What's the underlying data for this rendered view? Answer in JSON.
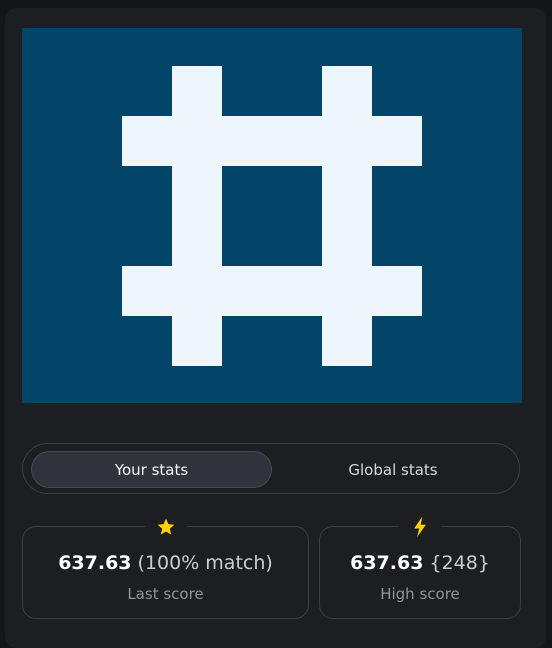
{
  "preview": {
    "background_color": "#034569",
    "glyph_color": "#eef6fc",
    "glyph": "hash-pattern"
  },
  "tabs": {
    "your_stats": "Your stats",
    "global_stats": "Global stats",
    "active": "your_stats"
  },
  "stats": {
    "last": {
      "icon": "star-icon",
      "icon_color": "#ffd200",
      "score": "637.63",
      "extra": "(100% match)",
      "label": "Last score"
    },
    "high": {
      "icon": "lightning-bolt-icon",
      "icon_color": "#ffd200",
      "score": "637.63",
      "extra": "{248}",
      "label": "High score"
    }
  }
}
